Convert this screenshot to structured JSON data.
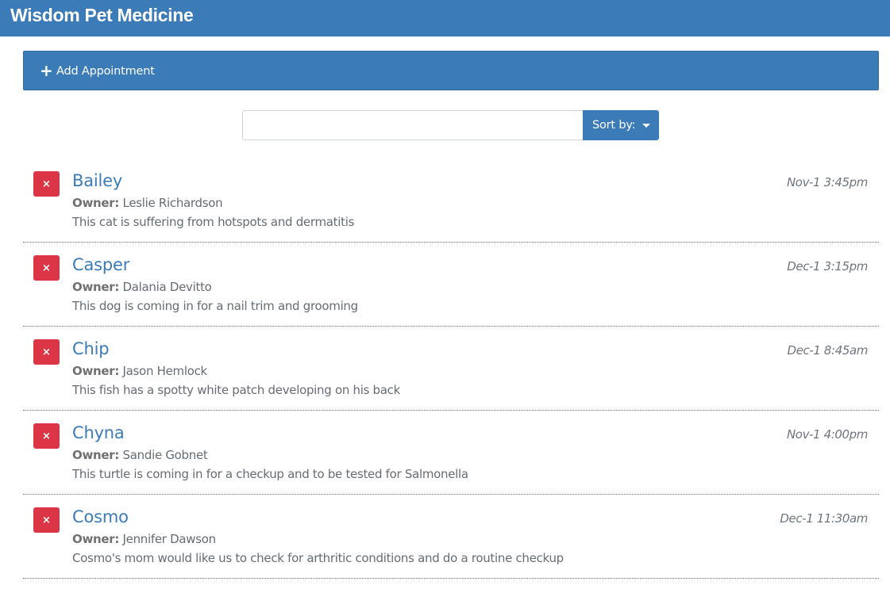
{
  "navbar": {
    "brand": "Wisdom Pet Medicine"
  },
  "add_appointment": {
    "icon": "plus-icon",
    "icon_glyph": "+",
    "label": "Add Appointment"
  },
  "search": {
    "value": "",
    "placeholder": ""
  },
  "sort": {
    "label": "Sort by:"
  },
  "colors": {
    "primary": "#3a7bb8",
    "danger": "#dc3545",
    "muted": "#6f757b"
  },
  "appointments": [
    {
      "delete_glyph": "×",
      "pet_name": "Bailey",
      "date": "Nov-1 3:45pm",
      "owner_label": "Owner:",
      "owner": "Leslie Richardson",
      "notes": "This cat is suffering from hotspots and dermatitis"
    },
    {
      "delete_glyph": "×",
      "pet_name": "Casper",
      "date": "Dec-1 3:15pm",
      "owner_label": "Owner:",
      "owner": "Dalania Devitto",
      "notes": "This dog is coming in for a nail trim and grooming"
    },
    {
      "delete_glyph": "×",
      "pet_name": "Chip",
      "date": "Dec-1 8:45am",
      "owner_label": "Owner:",
      "owner": "Jason Hemlock",
      "notes": "This fish has a spotty white patch developing on his back"
    },
    {
      "delete_glyph": "×",
      "pet_name": "Chyna",
      "date": "Nov-1 4:00pm",
      "owner_label": "Owner:",
      "owner": "Sandie Gobnet",
      "notes": "This turtle is coming in for a checkup and to be tested for Salmonella"
    },
    {
      "delete_glyph": "×",
      "pet_name": "Cosmo",
      "date": "Dec-1 11:30am",
      "owner_label": "Owner:",
      "owner": "Jennifer Dawson",
      "notes": "Cosmo's mom would like us to check for arthritic conditions and do a routine checkup"
    }
  ]
}
